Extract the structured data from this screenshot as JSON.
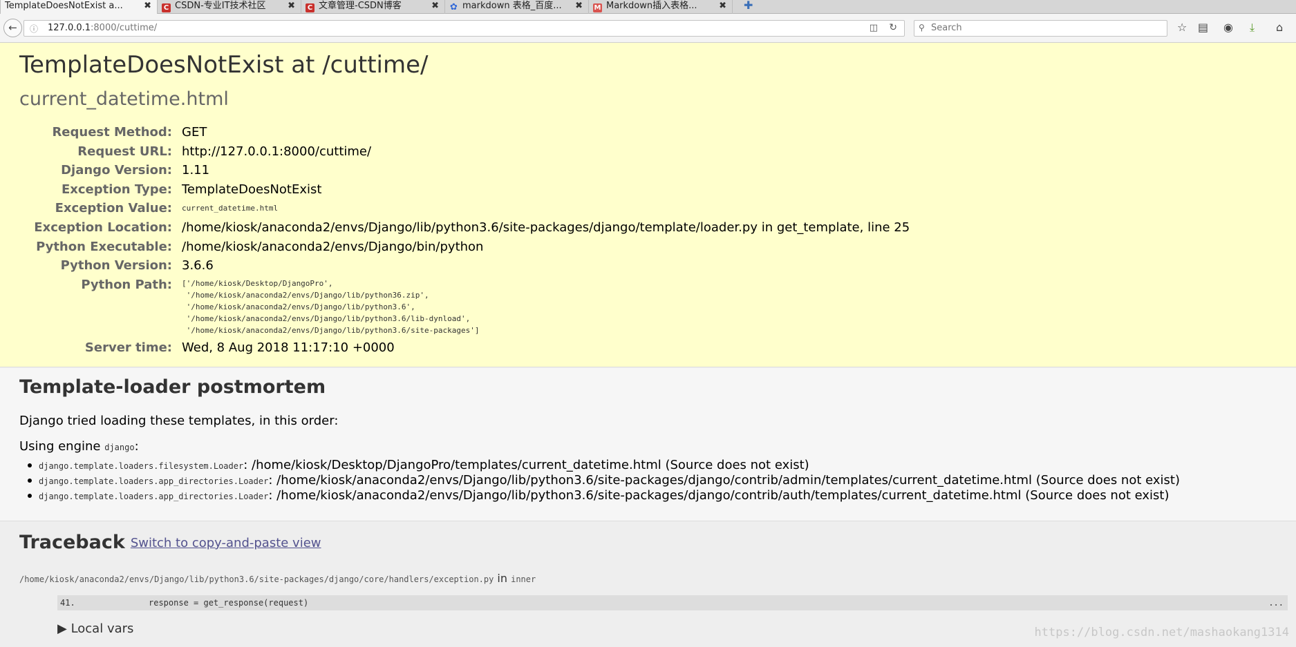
{
  "browser": {
    "tabs": [
      {
        "title": "TemplateDoesNotExist a...",
        "favicon": "page-icon",
        "active": true
      },
      {
        "title": "CSDN-专业IT技术社区",
        "favicon": "csdn-icon",
        "active": false
      },
      {
        "title": "文章管理-CSDN博客",
        "favicon": "csdn-icon",
        "active": false
      },
      {
        "title": "markdown 表格_百度...",
        "favicon": "baidu-paw-icon",
        "active": false
      },
      {
        "title": "Markdown插入表格...",
        "favicon": "site-icon",
        "active": false
      }
    ],
    "tab_close_glyph": "✖",
    "new_tab_glyph": "✚",
    "url_host": "127.0.0.1",
    "url_rest": ":8000/cuttime/",
    "search_placeholder": "Search",
    "colors": {
      "csdn": "#c9302c",
      "baidu": "#3168d8"
    }
  },
  "error": {
    "title": "TemplateDoesNotExist at /cuttime/",
    "subtitle": "current_datetime.html",
    "meta": [
      {
        "key": "Request Method:",
        "value": "GET"
      },
      {
        "key": "Request URL:",
        "value": "http://127.0.0.1:8000/cuttime/"
      },
      {
        "key": "Django Version:",
        "value": "1.11"
      },
      {
        "key": "Exception Type:",
        "value": "TemplateDoesNotExist"
      },
      {
        "key": "Exception Value:",
        "value": "current_datetime.html"
      },
      {
        "key": "Exception Location:",
        "value": "/home/kiosk/anaconda2/envs/Django/lib/python3.6/site-packages/django/template/loader.py in get_template, line 25"
      },
      {
        "key": "Python Executable:",
        "value": "/home/kiosk/anaconda2/envs/Django/bin/python"
      },
      {
        "key": "Python Version:",
        "value": "3.6.6"
      }
    ],
    "python_path_label": "Python Path:",
    "python_path": "['/home/kiosk/Desktop/DjangoPro',\n '/home/kiosk/anaconda2/envs/Django/lib/python36.zip',\n '/home/kiosk/anaconda2/envs/Django/lib/python3.6',\n '/home/kiosk/anaconda2/envs/Django/lib/python3.6/lib-dynload',\n '/home/kiosk/anaconda2/envs/Django/lib/python3.6/site-packages']",
    "server_time_label": "Server time:",
    "server_time": "Wed, 8 Aug 2018 11:17:10 +0000"
  },
  "postmortem": {
    "title": "Template-loader postmortem",
    "intro": "Django tried loading these templates, in this order:",
    "engine_prefix": "Using engine ",
    "engine": "django",
    "engine_suffix": ":",
    "items": [
      {
        "loader": "django.template.loaders.filesystem.Loader",
        "path": ": /home/kiosk/Desktop/DjangoPro/templates/current_datetime.html (Source does not exist)"
      },
      {
        "loader": "django.template.loaders.app_directories.Loader",
        "path": ": /home/kiosk/anaconda2/envs/Django/lib/python3.6/site-packages/django/contrib/admin/templates/current_datetime.html (Source does not exist)"
      },
      {
        "loader": "django.template.loaders.app_directories.Loader",
        "path": ": /home/kiosk/anaconda2/envs/Django/lib/python3.6/site-packages/django/contrib/auth/templates/current_datetime.html (Source does not exist)"
      }
    ]
  },
  "traceback": {
    "title": "Traceback",
    "switch_link": "Switch to copy-and-paste view",
    "frame_file": "/home/kiosk/anaconda2/envs/Django/lib/python3.6/site-packages/django/core/handlers/exception.py",
    "frame_in": " in ",
    "frame_func": "inner",
    "line_no": "41.",
    "line_code": "response = get_response(request)",
    "more": "...",
    "local_vars": "▶ Local vars"
  },
  "watermark": "https://blog.csdn.net/mashaokang1314"
}
